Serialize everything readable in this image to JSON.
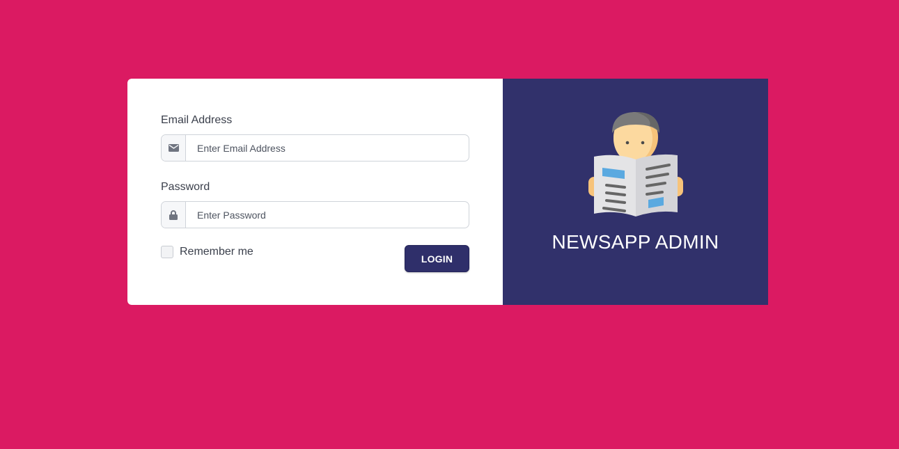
{
  "login_form": {
    "email": {
      "label": "Email Address",
      "placeholder": "Enter Email Address",
      "value": "",
      "icon": "envelope-icon"
    },
    "password": {
      "label": "Password",
      "placeholder": "Enter Password",
      "value": "",
      "icon": "lock-icon"
    },
    "remember_me": {
      "label": "Remember me",
      "checked": false
    },
    "submit_label": "LOGIN"
  },
  "brand": {
    "title": "NEWSAPP ADMIN",
    "illustration": "newspaper-reader-icon"
  },
  "colors": {
    "page_background": "#db1a62",
    "brand_panel": "#31316b",
    "button": "#2f2f6a",
    "form_panel": "#ffffff"
  }
}
